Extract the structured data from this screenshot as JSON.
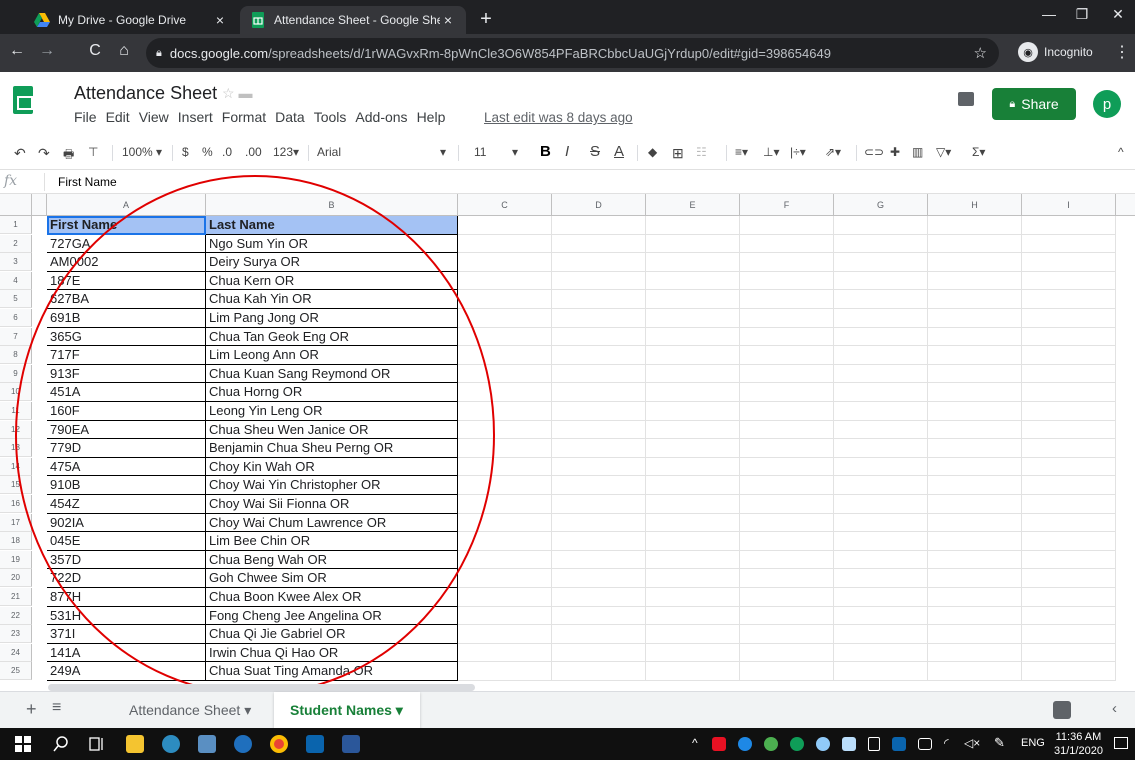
{
  "browser": {
    "tabs": [
      {
        "title": "My Drive - Google Drive",
        "close": "×"
      },
      {
        "title": "Attendance Sheet - Google Shee",
        "close": "×"
      }
    ],
    "new_tab": "+",
    "window_controls": [
      "—",
      "❐",
      "✕"
    ],
    "nav": {
      "back": "←",
      "forward": "→",
      "reload": "C",
      "home": "⌂"
    },
    "url_host": "docs.google.com",
    "url_path": "/spreadsheets/d/1rWAGvxRm-8pWnCle3O6W854PFaBRCbbcUaUGjYrdup0/edit#gid=398654649",
    "star": "☆",
    "incognito_label": "Incognito",
    "menu": "⋮"
  },
  "sheets": {
    "doc_title": "Attendance Sheet",
    "title_icons": "☆ ▬",
    "menus": [
      "File",
      "Edit",
      "View",
      "Insert",
      "Format",
      "Data",
      "Tools",
      "Add-ons",
      "Help"
    ],
    "last_edit": "Last edit was 8 days ago",
    "share_label": "Share",
    "avatar_letter": "p",
    "toolbar": {
      "undo": "↶",
      "redo": "↷",
      "print": "🖶",
      "paint": "⊤",
      "zoom": "100%",
      "zoom_caret": "▾",
      "currency": "$",
      "percent": "%",
      "dec_minus": ".0",
      "dec_plus": ".00",
      "format_more": "123▾",
      "font": "Arial",
      "font_caret": "▾",
      "font_size": "11",
      "size_caret": "▾",
      "bold": "B",
      "italic": "I",
      "strike": "S",
      "text_color": "A",
      "fill": "◆",
      "borders": "⊞",
      "merge": "☷",
      "halign": "≡▾",
      "valign": "⊥▾",
      "wrap": "|÷▾",
      "rotate": "⇗▾",
      "link": "⊂⊃",
      "comment": "✚",
      "chart": "▥",
      "filter": "▽▾",
      "functions": "Σ▾",
      "collapse": "^"
    },
    "formula": {
      "fx": "fx",
      "value": "First Name"
    },
    "columns": [
      "A",
      "B",
      "C",
      "D",
      "E",
      "F",
      "G",
      "H",
      "I"
    ],
    "rows": [
      "1",
      "2",
      "3",
      "4",
      "5",
      "6",
      "7",
      "8",
      "9",
      "10",
      "11",
      "12",
      "13",
      "14",
      "15",
      "16",
      "17",
      "18",
      "19",
      "20",
      "21",
      "22",
      "23",
      "24",
      "25"
    ],
    "table": {
      "header": [
        "First Name",
        "Last Name"
      ],
      "data": [
        [
          "727GA",
          "Ngo Sum Yin OR"
        ],
        [
          "AM0002",
          "Deiry Surya OR"
        ],
        [
          "187E",
          "Chua Kern OR"
        ],
        [
          "627BA",
          "Chua Kah Yin OR"
        ],
        [
          "691B",
          "Lim Pang Jong OR"
        ],
        [
          "365G",
          "Chua Tan Geok Eng OR"
        ],
        [
          "717F",
          "Lim Leong Ann OR"
        ],
        [
          "913F",
          "Chua Kuan Sang Reymond OR"
        ],
        [
          "451A",
          "Chua Horng OR"
        ],
        [
          "160F",
          "Leong Yin Leng OR"
        ],
        [
          "790EA",
          "Chua Sheu Wen Janice OR"
        ],
        [
          "779D",
          "Benjamin Chua Sheu Perng OR"
        ],
        [
          "475A",
          "Choy Kin Wah OR"
        ],
        [
          "910B",
          "Choy Wai Yin Christopher OR"
        ],
        [
          "454Z",
          "Choy Wai Sii Fionna OR"
        ],
        [
          "902IA",
          "Choy Wai Chum Lawrence OR"
        ],
        [
          "045E",
          "Lim Bee Chin OR"
        ],
        [
          "357D",
          "Chua Beng Wah OR"
        ],
        [
          "722D",
          "Goh Chwee Sim OR"
        ],
        [
          "877H",
          "Chua Boon Kwee Alex OR"
        ],
        [
          "531H",
          "Fong Cheng Jee Angelina OR"
        ],
        [
          "371I",
          "Chua Qi Jie Gabriel OR"
        ],
        [
          "141A",
          "Irwin Chua Qi Hao OR"
        ],
        [
          "249A",
          "Chua Suat Ting Amanda OR"
        ]
      ]
    },
    "sheet_tabs": {
      "add": "+",
      "all": "≡",
      "items": [
        {
          "label": "Attendance Sheet ▾"
        },
        {
          "label": "Student Names ▾"
        }
      ],
      "collapse": "‹"
    },
    "colors": {
      "header_fill": "#a4c2f4",
      "selection": "#1a73e8",
      "share": "#188038",
      "annotation": "#e00000"
    }
  },
  "taskbar": {
    "lang": "ENG",
    "time": "11:36 AM",
    "date": "31/1/2020"
  }
}
